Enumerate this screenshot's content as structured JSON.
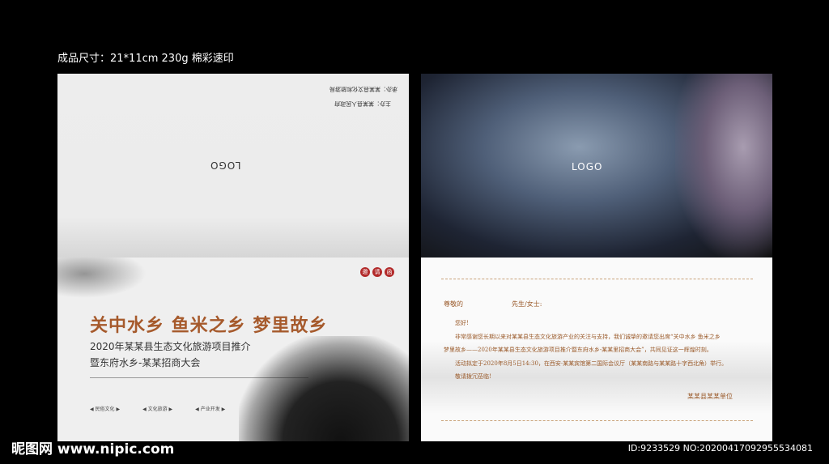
{
  "spec": "成品尺寸：21*11cm    230g  棉彩速印",
  "left_panel": {
    "back": {
      "host": "主办：某某县人民政府",
      "organizer": "承办：某某县文化和旅游局",
      "logo": "LOGO"
    },
    "front": {
      "stamp": [
        "邀",
        "请",
        "函"
      ],
      "title": "关中水乡 鱼米之乡 梦里故乡",
      "subtitle1": "2020年某某县生态文化旅游项目推介",
      "subtitle2": "暨东府水乡-某某招商大会",
      "tags": [
        "民俗文化",
        "文化旅游",
        "产业开发"
      ]
    }
  },
  "right_panel": {
    "logo": "LOGO",
    "letter": {
      "salutation": "尊敬的",
      "title_suffix": "先生/女士:",
      "greeting": "您好!",
      "p1": "非常感谢您长期以来对某某县生态文化旅游产业的关注与支持，我们诚挚的邀请您出席“关中水乡 鱼米之乡",
      "p1b": "梦里故乡——2020年某某县生态文化旅游项目推介暨东府水乡-某某里招商大会”，共同见证这一辉煌时刻。",
      "p2": "活动拟定于2020年8月5日14:30，在西安·某某宾馆第二国际会议厅（某某南路与某某路十字西北角）举行。",
      "p3": "敬请拨冗莅临!",
      "signature": "某某县某某单位"
    }
  },
  "watermark": "昵图网 www.nipic.com",
  "id_text": "ID:9233529 NO:20200417092955534081"
}
